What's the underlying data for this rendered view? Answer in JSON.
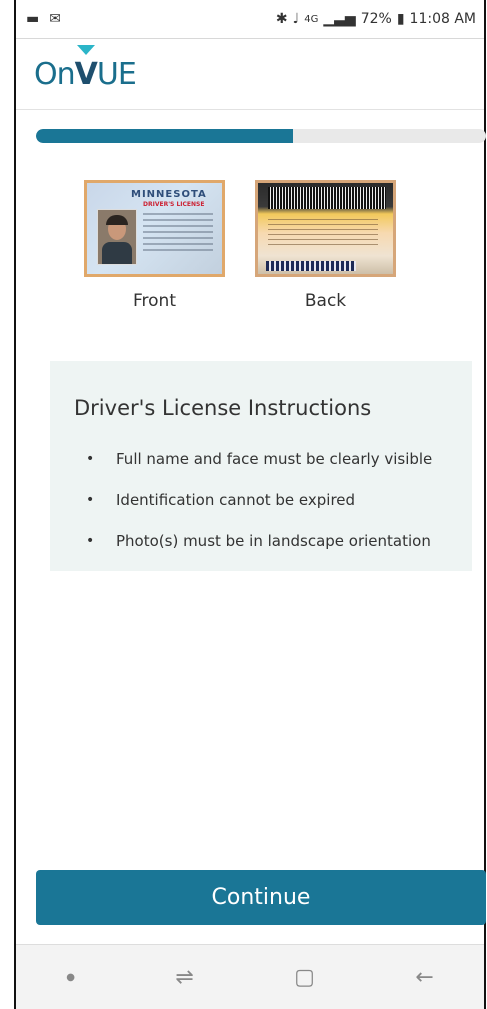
{
  "status_bar": {
    "battery": "72%",
    "time": "11:08 AM",
    "icons": [
      "chat-icon",
      "mail-icon",
      "bluetooth-icon",
      "mute-icon",
      "4g-icon",
      "signal-icon",
      "battery-icon"
    ]
  },
  "brand": {
    "logo_text_on": "On",
    "logo_text_vue": "VUE"
  },
  "progress": {
    "fraction": 0.57,
    "color": "#1a7696"
  },
  "id_cards": {
    "front_label": "Front",
    "back_label": "Back",
    "front_state": "MINNESOTA",
    "front_subtitle": "DRIVER'S LICENSE"
  },
  "instructions": {
    "title": "Driver's License Instructions",
    "items": [
      "Full name and face must be clearly visible",
      "Identification cannot be expired",
      "Photo(s) must be in landscape orientation"
    ]
  },
  "actions": {
    "continue_label": "Continue"
  },
  "colors": {
    "accent": "#1a7696",
    "panel": "#eef4f3"
  }
}
